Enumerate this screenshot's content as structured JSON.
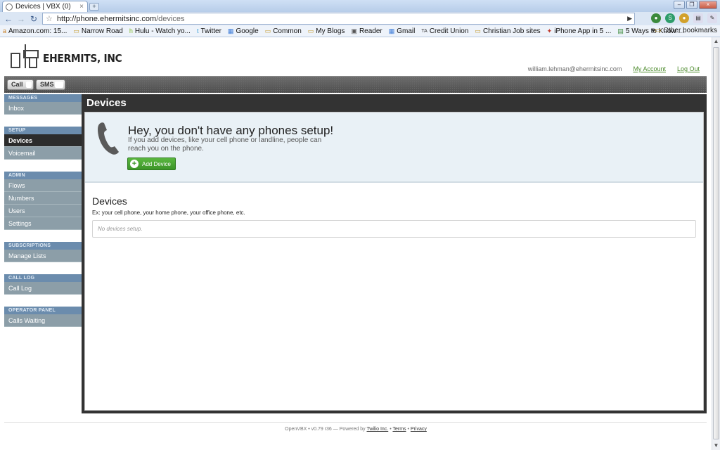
{
  "browser": {
    "tab_title": "Devices | VBX (0)",
    "url_domain": "http://phone.ehermitsinc.com",
    "url_path": "/devices",
    "bookmarks": [
      {
        "label": "Amazon.com: 15...",
        "icon": "amazon-icon"
      },
      {
        "label": "Narrow Road",
        "icon": "folder-icon"
      },
      {
        "label": "Hulu - Watch yo...",
        "icon": "hulu-icon"
      },
      {
        "label": "Twitter",
        "icon": "twitter-icon"
      },
      {
        "label": "Google",
        "icon": "google-icon"
      },
      {
        "label": "Common",
        "icon": "folder-icon"
      },
      {
        "label": "My Blogs",
        "icon": "folder-icon"
      },
      {
        "label": "Reader",
        "icon": "reader-icon"
      },
      {
        "label": "Gmail",
        "icon": "gmail-icon"
      },
      {
        "label": "Credit Union",
        "icon": "bank-icon"
      },
      {
        "label": "Christian Job sites",
        "icon": "folder-icon"
      },
      {
        "label": "iPhone App in 5 ...",
        "icon": "app-icon"
      },
      {
        "label": "5 Ways to Know ...",
        "icon": "page-icon"
      }
    ],
    "more_bookmarks": "»",
    "other_bookmarks": "Other bookmarks"
  },
  "header": {
    "logo_text": "EHERMITS, INC",
    "user_email": "william.lehman@ehermitsinc.com",
    "my_account": "My Account",
    "log_out": "Log Out"
  },
  "topnav": {
    "call_label": "Call",
    "sms_label": "SMS"
  },
  "sidebar": {
    "groups": [
      {
        "heading": "MESSAGES",
        "items": [
          "Inbox"
        ]
      },
      {
        "heading": "SETUP",
        "items": [
          "Devices",
          "Voicemail"
        ]
      },
      {
        "heading": "ADMIN",
        "items": [
          "Flows",
          "Numbers",
          "Users",
          "Settings"
        ]
      },
      {
        "heading": "SUBSCRIPTIONS",
        "items": [
          "Manage Lists"
        ]
      },
      {
        "heading": "CALL LOG",
        "items": [
          "Call Log"
        ]
      },
      {
        "heading": "OPERATOR PANEL",
        "items": [
          "Calls Waiting"
        ]
      }
    ],
    "active_item": "Devices"
  },
  "main": {
    "title": "Devices",
    "hero_title": "Hey, you don't have any phones setup!",
    "hero_text": "If you add devices, like your cell phone or landline, people can reach you on the phone.",
    "add_device_label": "Add Device",
    "devices_heading": "Devices",
    "devices_example": "Ex: your cell phone, your home phone, your office phone, etc.",
    "empty_message": "No devices setup."
  },
  "footer": {
    "prefix": "OpenVBX • v0.79 r36 — Powered by",
    "twilio": "Twilio Inc.",
    "sep1": "•",
    "terms": "Terms",
    "sep2": "•",
    "privacy": "Privacy"
  },
  "colors": {
    "accent_green": "#4d8b2d",
    "sidebar_item": "#8c9ea8",
    "sidebar_heading": "#6b8cad",
    "active_item": "#2c2c2c",
    "hero_bg": "#e9f1f6"
  }
}
